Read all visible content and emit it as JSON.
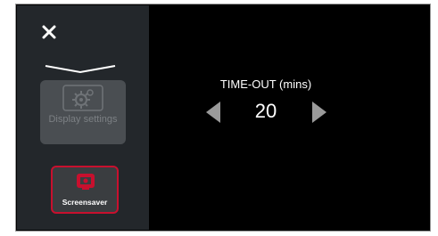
{
  "sidebar": {
    "close_icon": "close-icon",
    "tiles": [
      {
        "label": "Display settings",
        "icon": "display-settings-gear-icon",
        "state": "disabled"
      },
      {
        "label": "Screensaver",
        "icon": "screensaver-icon",
        "state": "selected"
      }
    ]
  },
  "timeout": {
    "title": "TIME-OUT (mins)",
    "value": "20",
    "decrease_icon": "arrow-left-icon",
    "increase_icon": "arrow-right-icon"
  },
  "colors": {
    "background": "#000000",
    "sidebar": "#23272b",
    "accent": "#c8102e",
    "disabled_tile": "#4a4e52"
  }
}
